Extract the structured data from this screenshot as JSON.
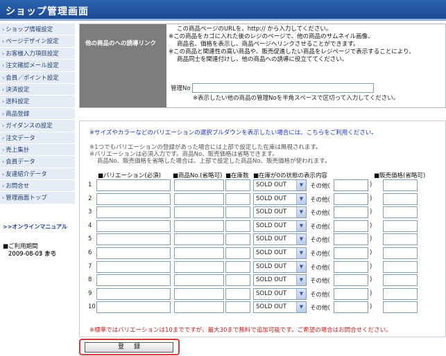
{
  "header": {
    "title": "ショップ管理画面"
  },
  "sidebar": {
    "items": [
      "ショップ情報設定",
      "ページデザイン設定",
      "お客様入力項目設定",
      "注文確認メール設定",
      "会員／ポイント設定",
      "決済設定",
      "送料設定",
      "商品登録",
      "ガイダンスの設定",
      "注文データ",
      "売上集計",
      "会員データ",
      "友達紹介データ",
      "お問合せ",
      "管理画面トップ"
    ],
    "manual_link": ">>オンラインマニュアル",
    "period_label": "■ご利用期間",
    "period_from": "2009-08-05  から",
    "period_to": "2009-08-07  まで"
  },
  "link_panel": {
    "label": "他の商品のへの誘導リンク",
    "lines": [
      "この商品ページのURLを、http:// から入力してください。",
      "※この商品をカゴに入れた後のレジのページで、他の商品のサムネイル画像、",
      "商品名、価格を表示し、商品ページへリンクさせることができます。",
      "※この商品と関連性の高い商品や、販売促進したい商品をレジページで表示することにより、",
      "商品同士を関連付けし、他の商品への誘導に役立ててください。"
    ],
    "mgmt_label": "管理No",
    "mgmt_value": "",
    "mgmt_note": "※表示したい他の商品の管理Noを半角スペースで区切って入力してください。"
  },
  "variation": {
    "notice": "※サイズやカラーなどのバリエーションの選択プルダウンを表示したい場合には、こちらをご利用ください。",
    "notes": [
      "※1つでもバリエーションの登録があった場合には上部で設定した在庫は無視されます。",
      "※バリエーションは必須入力です。商品No、販売価格は省略できます。",
      "商品No、販売価格を省略した場合は、上部で設定した商品No、販売価格が使われます。"
    ],
    "headers": {
      "variation": "■バリエーション(必須)",
      "product_no": "■商品No.(省略可)",
      "stock": "■在庫数",
      "zero_stock": "■在庫が0の状態の表示内容",
      "price": "■販売価格(省略可)"
    },
    "select_value": "SOLD OUT",
    "other_label": "その他(",
    "other_close": ")",
    "rows": [
      "1",
      "2",
      "3",
      "4",
      "5",
      "6",
      "7",
      "8",
      "9",
      "10"
    ],
    "bottom_note": "※標準ではバリエーションは10までですが、最大30まで無料で追加可能です。ご希望の場合はお問合せください。"
  },
  "submit": {
    "label": "登録"
  }
}
